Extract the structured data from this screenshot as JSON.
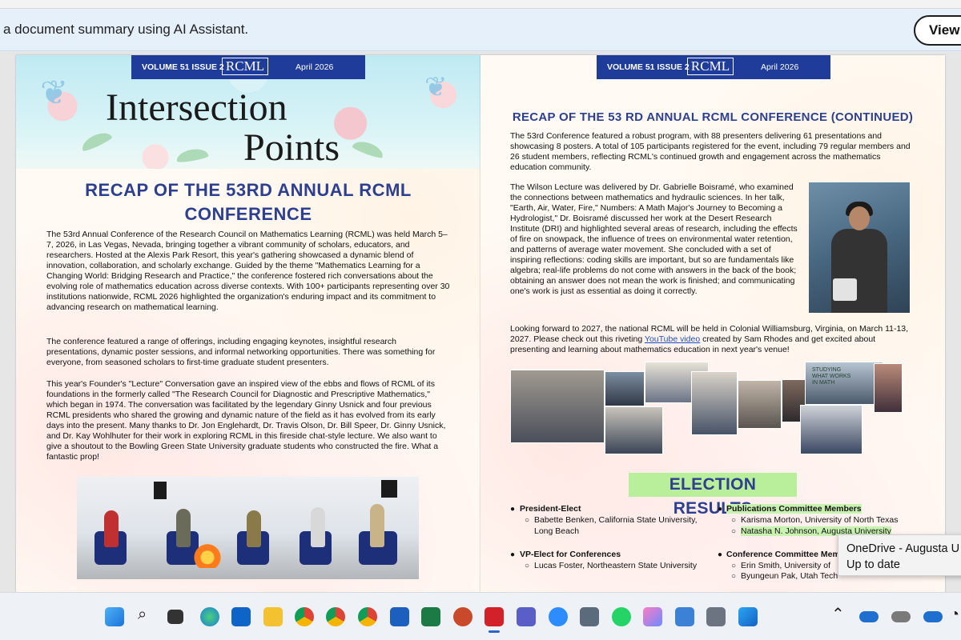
{
  "banner": {
    "message": "a document summary using AI Assistant.",
    "view_label": "View"
  },
  "newsletter": {
    "volume": "VOLUME 51 ISSUE 2",
    "logo": "RCML",
    "date": "April 2026",
    "mast_line1": "Intersection",
    "mast_line2": "Points"
  },
  "left_page": {
    "heading_line1": "RECAP OF THE 53RD ANNUAL RCML",
    "heading_line2": "CONFERENCE",
    "para1": "The 53rd Annual Conference of the Research Council on Mathematics Learning (RCML) was held March 5–7, 2026, in Las Vegas, Nevada, bringing together a vibrant community of scholars, educators, and researchers. Hosted at the Alexis Park Resort, this year's gathering showcased a dynamic blend of innovation, collaboration, and scholarly exchange. Guided by the theme \"Mathematics Learning for a Changing World: Bridging Research and Practice,\" the conference fostered rich conversations about the evolving role of mathematics education across diverse contexts. With 100+ participants representing over 30 institutions nationwide, RCML 2026 highlighted the organization's enduring impact and its commitment to advancing research on mathematical learning.",
    "para2": "The conference featured a range of offerings, including engaging keynotes, insightful research presentations, dynamic poster sessions, and informal networking opportunities. There was something for everyone, from seasoned scholars to first-time graduate student presenters.",
    "para3": "This year's Founder's \"Lecture\" Conversation gave an inspired view of the ebbs and flows of RCML of its foundations in the formerly called \"The Research Council for Diagnostic and Prescriptive Mathematics,\" which began in 1974. The conversation was facilitated by the legendary Ginny Usnick and four previous RCML presidents who shared the growing and dynamic nature of the field as it has evolved from its early days into the present. Many thanks to Dr. Jon Englehardt, Dr. Travis Olson, Dr. Bill Speer, Dr. Ginny Usnick, and Dr. Kay Wohlhuter for their work in exploring RCML in this fireside chat-style lecture. We also want to give a shoutout to the Bowling Green State University graduate students who constructed the fire. What a fantastic prop!"
  },
  "right_page": {
    "heading": "RECAP OF THE 53 RD ANNUAL RCML CONFERENCE (CONTINUED)",
    "para1": "The 53rd Conference featured a robust program, with 88 presenters delivering 61 presentations and showcasing 8 posters. A total of 105 participants registered for the event, including 79 regular members and 26 student members, reflecting RCML's continued growth and engagement across the mathematics education community.",
    "para2": "The Wilson Lecture was delivered by Dr. Gabrielle Boisramé, who examined the connections between mathematics and hydraulic sciences. In her talk, \"Earth, Air, Water, Fire,\" Numbers: A Math Major's Journey to Becoming a Hydrologist,\" Dr. Boisramé discussed her work at the Desert Research Institute (DRI) and highlighted several areas of research, including the effects of fire on snowpack, the influence of trees on environmental water retention, and patterns of average water movement. She concluded with a set of inspiring reflections: coding skills are important, but so are fundamentals like algebra; real-life problems do not come with answers in the back of the book; obtaining an answer does not mean the work is finished; and communicating one's work is just as essential as doing it correctly.",
    "para3_before": "Looking forward to 2027, the national RCML will be held in Colonial Williamsburg, Virginia, on March 11-13, 2027. Please check out this riveting ",
    "para3_link": "YouTube video",
    "para3_after": " created by Sam Rhodes and get excited about presenting and learning about mathematics education in next year's venue!",
    "poster_text": "STUDYING WHAT WORKS IN MATH",
    "election_heading": "ELECTION RESULTS",
    "elections": {
      "president_elect": "President-Elect",
      "president_name1": "Babette Benken, California State University,",
      "president_name2": "Long Beach",
      "vp_elect": "VP-Elect for Conferences",
      "vp_name": "Lucas Foster, Northeastern State University",
      "pub_committee": "Publications Committee Members",
      "pub_name1": "Karisma Morton, University of North Texas",
      "pub_name2": "Natasha N. Johnson, Augusta University",
      "conf_committee": "Conference Committee Mem",
      "conf_name1": "Erin Smith, University of",
      "conf_name2": "Byungeun Pak, Utah Tech"
    }
  },
  "toast": {
    "line1": "OneDrive - Augusta U",
    "line2": "Up to date"
  },
  "taskbar": {
    "icons": [
      "windows-start",
      "search",
      "task-view",
      "edge",
      "outlook",
      "file-explorer",
      "chrome",
      "chrome",
      "chrome",
      "word",
      "excel",
      "powerpoint",
      "acrobat",
      "teams",
      "zoom",
      "calculator",
      "whatsapp",
      "photos",
      "notepad",
      "camera",
      "paint"
    ],
    "colors": {
      "accent": "#1f3c9a",
      "heading": "#2e3f8f",
      "election_highlight": "#b9ef9a"
    }
  }
}
